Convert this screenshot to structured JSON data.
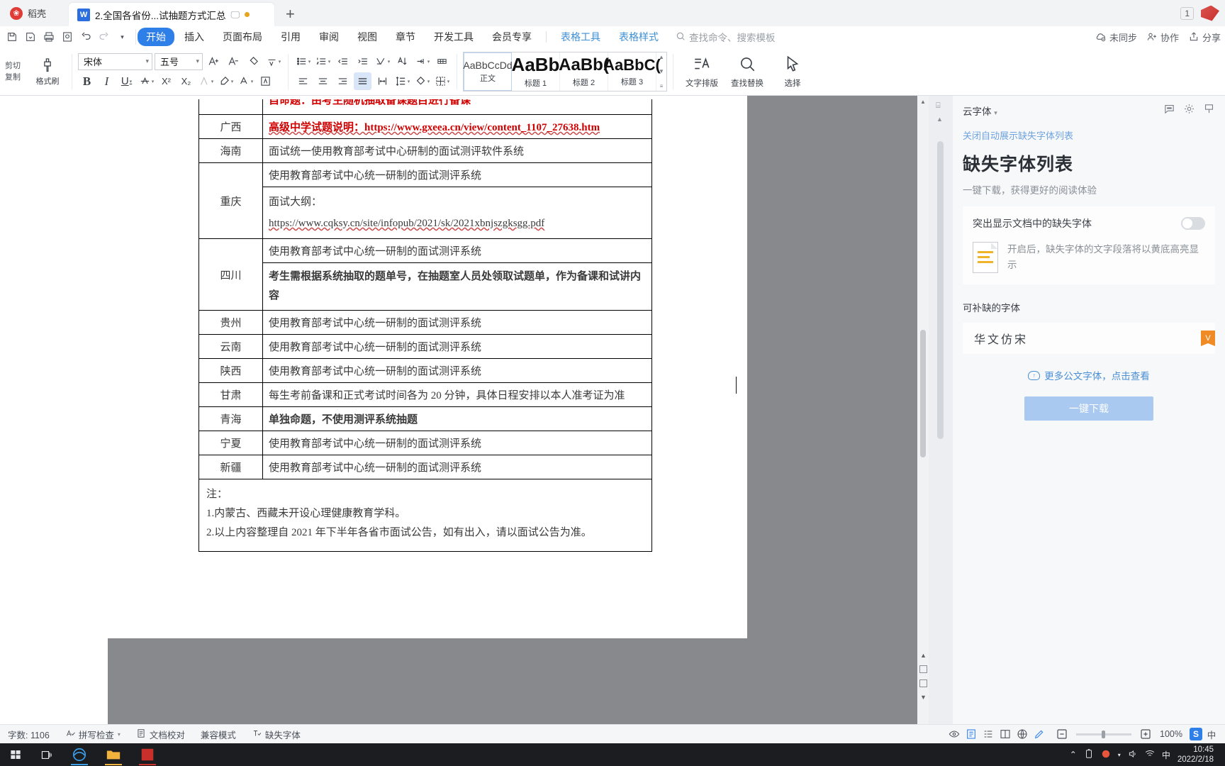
{
  "titlebar": {
    "brand_label": "稻壳",
    "brand_icon": "wps-docer-icon",
    "tab_title": "2.全国各省份...试抽题方式汇总",
    "tab_app_icon": "wps-writer-icon",
    "tab_mini_icon": "screen-icon",
    "new_tab_label": "+",
    "window_count": "1"
  },
  "ribbon": {
    "quick_access": [
      "save-icon",
      "save-as-icon",
      "print-icon",
      "print-preview-icon",
      "undo-icon",
      "redo-icon",
      "customize-icon"
    ],
    "tabs": [
      {
        "label": "开始",
        "active": true
      },
      {
        "label": "插入",
        "active": false
      },
      {
        "label": "页面布局",
        "active": false
      },
      {
        "label": "引用",
        "active": false
      },
      {
        "label": "审阅",
        "active": false
      },
      {
        "label": "视图",
        "active": false
      },
      {
        "label": "章节",
        "active": false
      },
      {
        "label": "开发工具",
        "active": false
      },
      {
        "label": "会员专享",
        "active": false
      }
    ],
    "context_tabs": [
      {
        "label": "表格工具"
      },
      {
        "label": "表格样式"
      }
    ],
    "search_placeholder": "查找命令、搜索模板",
    "search_icon": "search-icon",
    "right_actions": [
      {
        "label": "未同步",
        "icon": "cloud-sync-off-icon"
      },
      {
        "label": "协作",
        "icon": "collaborate-icon"
      },
      {
        "label": "分享",
        "icon": "share-icon"
      }
    ],
    "clipboard": {
      "cut_label": "剪切",
      "copy_label": "复制",
      "format_painter_label": "格式刷"
    },
    "font": {
      "family_value": "宋体",
      "size_value": "五号",
      "grow_icon": "increase-font-size-icon",
      "shrink_icon": "decrease-font-size-icon",
      "clear_format_icon": "clear-format-icon",
      "pinyin_icon": "phonetic-guide-icon",
      "bold_label": "B",
      "italic_label": "I",
      "underline_label": "U",
      "strikethrough_icon": "strikethrough-icon",
      "superscript_label": "X²",
      "subscript_label": "X₂",
      "char_border_icon": "character-border-icon",
      "highlight_icon": "text-highlight-icon",
      "font_color_icon": "font-color-icon",
      "char_shading_icon": "character-shading-icon"
    },
    "paragraph": {
      "bullets_icon": "bullet-list-icon",
      "numbering_icon": "numbered-list-icon",
      "outdent_icon": "decrease-indent-icon",
      "indent_icon": "increase-indent-icon",
      "asian_layout_icon": "asian-layout-icon",
      "sort_icon": "sort-icon",
      "show_marks_icon": "show-paragraph-marks-icon",
      "grid_icon": "document-grid-icon",
      "align_left_icon": "align-left-icon",
      "align_center_icon": "align-center-icon",
      "align_right_icon": "align-right-icon",
      "align_justify_icon": "align-justify-icon",
      "distribute_icon": "distribute-icon",
      "line_spacing_icon": "line-spacing-icon",
      "shading_icon": "paragraph-shading-icon",
      "borders_icon": "borders-icon"
    },
    "styles": [
      {
        "preview": "AaBbCcDd",
        "name": "正文",
        "selected": true
      },
      {
        "preview": "AaBb",
        "name": "标题 1",
        "selected": false
      },
      {
        "preview": "AaBb(",
        "name": "标题 2",
        "selected": false
      },
      {
        "preview": "AaBbC(",
        "name": "标题 3",
        "selected": false
      }
    ],
    "tools": [
      {
        "label": "文字排版",
        "icon": "text-layout-icon"
      },
      {
        "label": "查找替换",
        "icon": "find-replace-icon"
      },
      {
        "label": "选择",
        "icon": "select-cursor-icon"
      }
    ]
  },
  "document": {
    "clipped_top_row": "自命题：由考生随机抽取备课题目进行备课",
    "rows": [
      {
        "province": "广西",
        "lines": [
          {
            "text": "高级中学试题说明：https://www.gxeea.cn/view/content_1107_27638.htm",
            "style": "red-link"
          }
        ]
      },
      {
        "province": "海南",
        "lines": [
          {
            "text": "面试统一使用教育部考试中心研制的面试测评软件系统",
            "style": "normal"
          }
        ]
      },
      {
        "province": "重庆",
        "lines": [
          {
            "text": "使用教育部考试中心统一研制的面试测评系统",
            "style": "normal"
          },
          {
            "text": "面试大纲：",
            "style": "normal"
          },
          {
            "text": "https://www.cqksy.cn/site/infopub/2021/sk/2021xbnjszgksgg.pdf",
            "style": "link"
          }
        ]
      },
      {
        "province": "四川",
        "lines": [
          {
            "text": "使用教育部考试中心统一研制的面试测评系统",
            "style": "normal"
          },
          {
            "text": "考生需根据系统抽取的题单号，在抽题室人员处领取试题单，作为备课和试讲内容",
            "style": "red"
          }
        ]
      },
      {
        "province": "贵州",
        "lines": [
          {
            "text": "使用教育部考试中心统一研制的面试测评系统",
            "style": "normal"
          }
        ]
      },
      {
        "province": "云南",
        "lines": [
          {
            "text": "使用教育部考试中心统一研制的面试测评系统",
            "style": "normal"
          }
        ]
      },
      {
        "province": "陕西",
        "lines": [
          {
            "text": "使用教育部考试中心统一研制的面试测评系统",
            "style": "normal"
          }
        ]
      },
      {
        "province": "甘肃",
        "lines": [
          {
            "text": "每生考前备课和正式考试时间各为 20 分钟，具体日程安排以本人准考证为准",
            "style": "normal"
          }
        ]
      },
      {
        "province": "青海",
        "lines": [
          {
            "text": "单独命题，不使用测评系统抽题",
            "style": "red"
          }
        ]
      },
      {
        "province": "宁夏",
        "lines": [
          {
            "text": "使用教育部考试中心统一研制的面试测评系统",
            "style": "normal"
          }
        ]
      },
      {
        "province": "新疆",
        "lines": [
          {
            "text": "使用教育部考试中心统一研制的面试测评系统",
            "style": "normal"
          }
        ]
      }
    ],
    "notes": [
      "注：",
      "1.内蒙古、西藏未开设心理健康教育学科。",
      "2.以上内容整理自 2021 年下半年各省市面试公告，如有出入，请以面试公告为准。"
    ]
  },
  "right_panel": {
    "panel_title": "云字体",
    "header_icons": [
      "comment-icon",
      "settings-icon",
      "pin-icon"
    ],
    "close_auto_link": "关闭自动展示缺失字体列表",
    "heading": "缺失字体列表",
    "subheading": "一键下载，获得更好的阅读体验",
    "highlight_row_label": "突出显示文档中的缺失字体",
    "highlight_toggle_state": "off",
    "tip_icon": "document-highlight-icon",
    "tip_text": "开启后，缺失字体的文字段落将以黄底高亮显示",
    "section_label": "可补缺的字体",
    "font_items": [
      {
        "name": "华文仿宋",
        "badge": "vip-badge"
      }
    ],
    "more_link": "更多公文字体，点击查看",
    "more_link_icon": "cloud-download-icon",
    "download_button": "一键下载"
  },
  "statusbar": {
    "word_count": "字数: 1106",
    "spellcheck": "拼写检查",
    "spellcheck_icon": "spellcheck-icon",
    "proofread": "文档校对",
    "proofread_icon": "proofread-icon",
    "compat_mode": "兼容模式",
    "missing_font": "缺失字体",
    "missing_font_icon": "missing-font-icon",
    "view_icons": [
      "eye-icon",
      "page-view-icon",
      "outline-view-icon",
      "reading-view-icon",
      "web-view-icon",
      "edit-icon"
    ],
    "zoom_out_icon": "zoom-out-icon",
    "zoom_in_icon": "zoom-in-icon",
    "zoom_level": "100%",
    "sogou_label": "S",
    "ime_label": "中"
  },
  "taskbar": {
    "start_icon": "windows-start-icon",
    "taskview_icon": "task-view-icon",
    "apps": [
      {
        "name": "edge-icon",
        "color": "#2b8ccc"
      },
      {
        "name": "file-explorer-icon",
        "color": "#f2b33d"
      },
      {
        "name": "wps-writer-icon",
        "color": "#c9302c"
      }
    ],
    "tray_icons": [
      "chevron-up-icon",
      "battery-icon",
      "sogou-icon",
      "volume-icon",
      "network-icon",
      "ime-cn-icon"
    ],
    "clock_time": "10:45",
    "clock_date": "2022/2/18"
  }
}
